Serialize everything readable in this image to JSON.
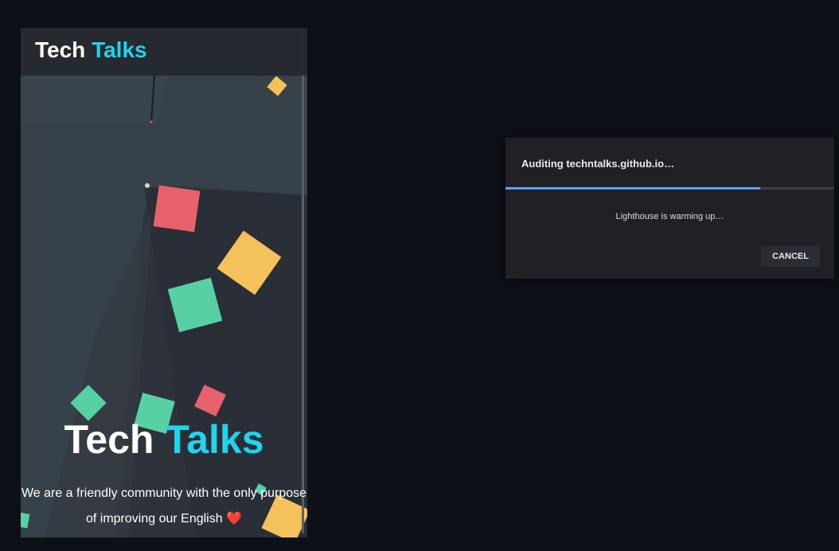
{
  "navbar": {
    "brand_part1": "Tech",
    "brand_part2": "Talks"
  },
  "hero": {
    "title_part1": "Tech",
    "title_part2": "Talks",
    "description": "We are a friendly community with the only purpose of improving our English",
    "heart_emoji": "❤️"
  },
  "audit_dialog": {
    "title": "Auditing techntalks.github.io…",
    "status": "Lighthouse is warming up…",
    "cancel_label": "CANCEL",
    "progress_fraction": 0.775
  },
  "colors": {
    "accent": "#22d3ee",
    "square_red": "#e8626e",
    "square_yellow": "#f5c15a",
    "square_green": "#57d0a3",
    "progress": "#669df6"
  }
}
